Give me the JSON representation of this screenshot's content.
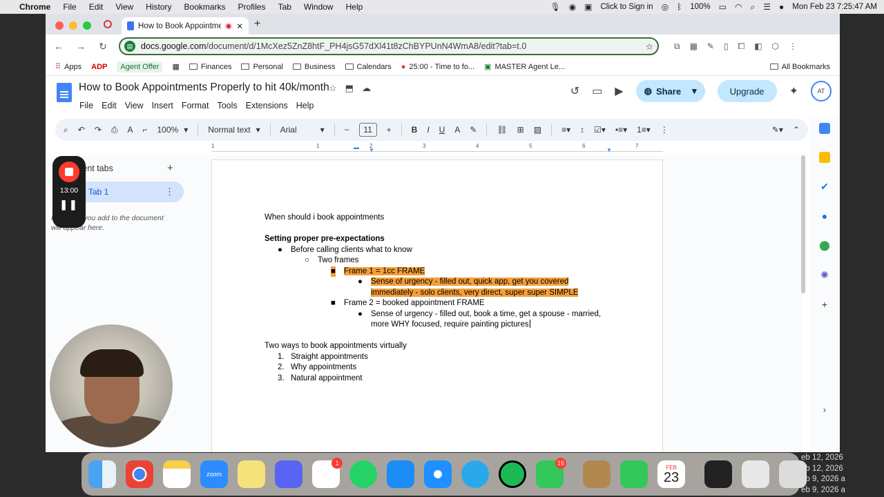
{
  "menubar": {
    "app": "Chrome",
    "items": [
      "File",
      "Edit",
      "View",
      "History",
      "Bookmarks",
      "Profiles",
      "Tab",
      "Window",
      "Help"
    ],
    "click_to_sign_in": "Click to Sign in",
    "battery": "100%",
    "datetime": "Mon Feb 23  7:25:47 AM"
  },
  "browser": {
    "tab_title": "How to Book Appointme",
    "url_domain": "docs.google.com",
    "url_path": "/document/d/1McXez5ZnZ8htF_PH4jsG57dXl41t8zChBYPUnN4WmA8/edit?tab=t.0",
    "bookmarks": [
      {
        "label": "Apps",
        "kind": "apps"
      },
      {
        "label": "ADP",
        "kind": "text"
      },
      {
        "label": "Agent Offer",
        "kind": "badge"
      },
      {
        "label": "Finances",
        "kind": "folder"
      },
      {
        "label": "Personal",
        "kind": "folder"
      },
      {
        "label": "Business",
        "kind": "folder"
      },
      {
        "label": "Calendars",
        "kind": "folder"
      },
      {
        "label": "25:00 - Time to fo...",
        "kind": "text"
      },
      {
        "label": "MASTER Agent Le...",
        "kind": "text"
      }
    ],
    "all_bookmarks": "All Bookmarks"
  },
  "doc": {
    "title": "How to Book Appointments Properly to hit 40k/month",
    "menus": [
      "File",
      "Edit",
      "View",
      "Insert",
      "Format",
      "Tools",
      "Extensions",
      "Help"
    ],
    "share_label": "Share",
    "upgrade_label": "Upgrade",
    "avatar_initials": "AT",
    "toolbar": {
      "zoom": "100%",
      "style": "Normal text",
      "font": "Arial",
      "font_size": "11"
    },
    "ruler": [
      "1",
      "1",
      "2",
      "3",
      "4",
      "5",
      "6",
      "7"
    ],
    "side": {
      "tabs_label": "ument tabs",
      "tab1": "Tab 1",
      "hint": "Headings you add to the document will appear here."
    },
    "body": {
      "p1": "When should i book appointments",
      "h1": "Setting proper pre-expectations",
      "b1": "Before calling clients what to know",
      "b2": "Two frames",
      "f1": "Frame 1 = 1cc FRAME",
      "f1a": "Sense of urgency - filled out, quick app, get you covered",
      "f1b": "immediately - solo clients, very direct, super super SIMPLE",
      "f2": "Frame 2 = booked appointment FRAME",
      "f2a": "Sense of urgency - filled out, book a time, get a spouse - married,",
      "f2b": "more WHY focused, require painting pictures",
      "p2": "Two ways to book appointments virtually",
      "n1": "Straight appointments",
      "n2": "Why appointments",
      "n3": "Natural appointment"
    }
  },
  "recorder": {
    "time": "13:00"
  },
  "dock": {
    "reminders_badge": "1",
    "messages_badge": "16",
    "calendar_month": "FEB",
    "calendar_day": "23"
  },
  "desktop_files": [
    "eb 12, 2026",
    "eb 12, 2026",
    "eb 9, 2026 a",
    "eb 9, 2026 a"
  ]
}
